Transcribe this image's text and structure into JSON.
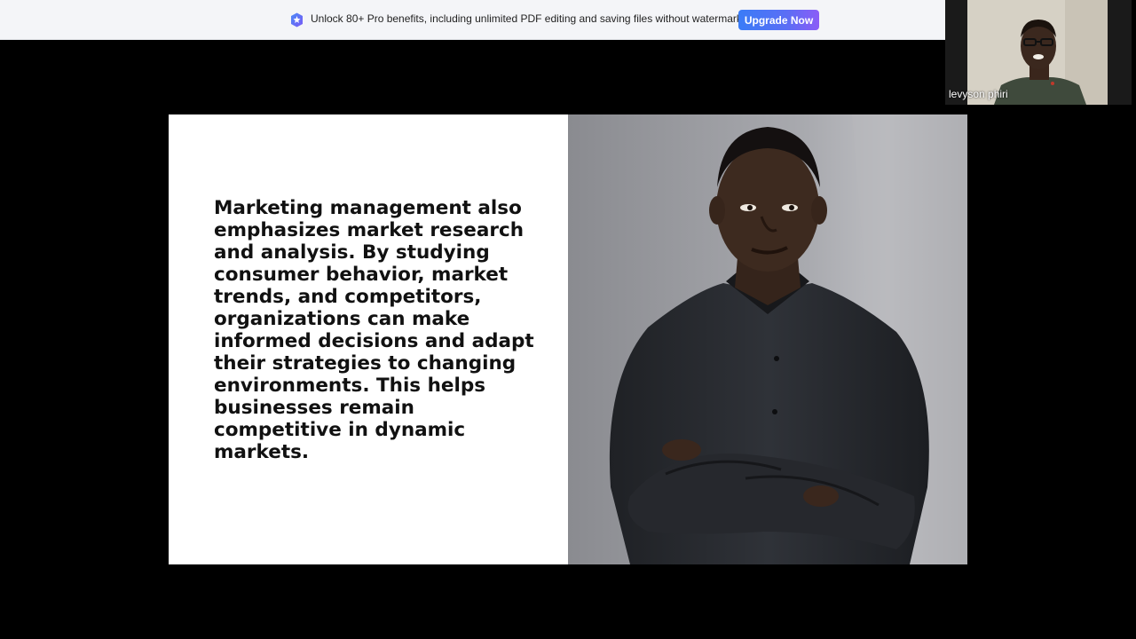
{
  "banner": {
    "message": "Unlock 80+ Pro benefits, including unlimited PDF editing and saving files without watermark.",
    "upgrade_label": "Upgrade Now",
    "icon": "pro-shield-icon",
    "accent": "#3a7cf7"
  },
  "webcam": {
    "participant_name": "levyson phiri"
  },
  "slide": {
    "body_text": "Marketing management also emphasizes market research and analysis. By studying consumer behavior, market trends, and competitors, organizations can make informed decisions and adapt their strategies to changing environments. This helps businesses remain competitive in dynamic markets.",
    "photo": "person-photo"
  },
  "colors": {
    "background": "#000000",
    "slide_background": "#ffffff",
    "banner_background": "#f4f5f8"
  }
}
